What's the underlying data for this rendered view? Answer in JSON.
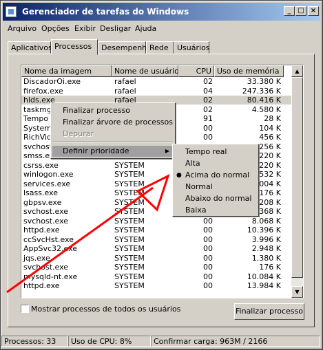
{
  "window": {
    "title": "Gerenciador de tarefas do Windows",
    "minimize": "_",
    "maximize": "□",
    "close": "×"
  },
  "menu": [
    "Arquivo",
    "Opções",
    "Exibir",
    "Desligar",
    "Ajuda"
  ],
  "tabs": [
    "Aplicativos",
    "Processos",
    "Desempenho",
    "Rede",
    "Usuários"
  ],
  "columns": [
    "Nome da imagem",
    "Nome de usuário",
    "CPU",
    "Uso de memória"
  ],
  "rows": [
    [
      "DiscadorOi.exe",
      "rafael",
      "02",
      "33.380 K"
    ],
    [
      "firefox.exe",
      "rafael",
      "04",
      "247.336 K"
    ],
    [
      "hlds.exe",
      "rafael",
      "02",
      "80.416 K"
    ],
    [
      "taskmgr",
      "",
      "02",
      "4.580 K"
    ],
    [
      "Tempo d",
      "",
      "91",
      "28 K"
    ],
    [
      "System",
      "",
      "00",
      "104 K"
    ],
    [
      "RichVide",
      "",
      "00",
      "456 K"
    ],
    [
      "svchost",
      "",
      "",
      ".256 K"
    ],
    [
      "smss.exe",
      "SYSTEM",
      "",
      "220 K"
    ],
    [
      "csrss.exe",
      "SYSTEM",
      "",
      ".220 K"
    ],
    [
      "winlogon.exe",
      "SYSTEM",
      "",
      ".532 K"
    ],
    [
      "services.exe",
      "SYSTEM",
      "",
      ".004 K"
    ],
    [
      "lsass.exe",
      "SYSTEM",
      "",
      ".176 K"
    ],
    [
      "gbpsv.exe",
      "SYSTEM",
      "",
      "208 K"
    ],
    [
      "svchost.exe",
      "SYSTEM",
      "",
      ".368 K"
    ],
    [
      "svchost.exe",
      "SYSTEM",
      "00",
      "8.068 K"
    ],
    [
      "httpd.exe",
      "SYSTEM",
      "00",
      "10.396 K"
    ],
    [
      "ccSvcHst.exe",
      "SYSTEM",
      "00",
      "3.996 K"
    ],
    [
      "AppSvc32.exe",
      "SYSTEM",
      "00",
      "2.948 K"
    ],
    [
      "jqs.exe",
      "SYSTEM",
      "00",
      "1.380 K"
    ],
    [
      "svchost.exe",
      "SYSTEM",
      "00",
      "176 K"
    ],
    [
      "mysqld-nt.exe",
      "SYSTEM",
      "00",
      "10.084 K"
    ],
    [
      "httpd.exe",
      "SYSTEM",
      "00",
      "13.984 K"
    ]
  ],
  "context_menu": {
    "items": [
      "Finalizar processo",
      "Finalizar árvore de processos",
      "Depurar",
      "Definir prioridade"
    ],
    "submenu_arrow": "▶"
  },
  "priority_menu": {
    "items": [
      "Tempo real",
      "Alta",
      "Acima do normal",
      "Normal",
      "Abaixo do normal",
      "Baixa"
    ],
    "checked": "Acima do normal",
    "bullet": "●"
  },
  "show_all_users_label": "Mostrar processos de todos os usuários",
  "end_process_button": "Finalizar processo",
  "status": {
    "processes": "Processos: 33",
    "cpu": "Uso de CPU: 8%",
    "commit": "Confirmar carga: 963M / 2166"
  },
  "colors": {
    "annotation_arrow": "#ff0000",
    "title_gradient_start": "#0a246a",
    "title_gradient_end": "#a6caf0"
  },
  "scroll": {
    "up": "▲",
    "down": "▼"
  }
}
